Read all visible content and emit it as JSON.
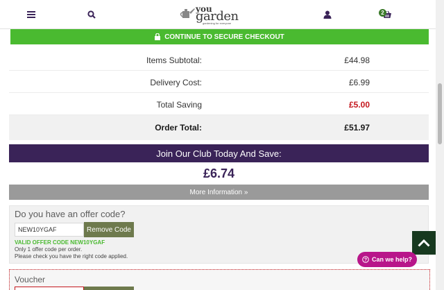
{
  "header": {
    "icons": [
      "hamburger-menu-icon",
      "search-icon",
      "account-icon",
      "basket-icon"
    ],
    "basket_count": "2",
    "logo_you": "you",
    "logo_garden": "garden",
    "logo_tagline": "gardening for everyone"
  },
  "checkout": {
    "label": "CONTINUE TO SECURE CHECKOUT",
    "icon": "padlock-icon"
  },
  "totals": {
    "subtotal_label": "Items Subtotal:",
    "subtotal_value": "£44.98",
    "delivery_label": "Delivery Cost:",
    "delivery_value": "£6.99",
    "saving_label": "Total Saving",
    "saving_value": "£5.00",
    "order_label": "Order Total:",
    "order_value": "£51.97"
  },
  "club": {
    "heading": "Join Our Club Today And Save:",
    "price": "£6.74",
    "more_info": "More Information »"
  },
  "offer": {
    "title": "Do you have an offer code?",
    "code_value": "NEW10YGAF",
    "remove_label": "Remove Code",
    "valid_text": "VALID OFFER CODE NEW10YGAF",
    "note1": "Only 1 offer code per order.",
    "note2": "Please check you have the right code applied."
  },
  "voucher": {
    "title": "Voucher"
  },
  "help": {
    "label": "Can we help?"
  },
  "colors": {
    "brand_green": "#4aba30",
    "club_purple": "#3a2358",
    "saving_red": "#c4161c",
    "help_magenta": "#b8168a",
    "button_olive": "#6e7a4d"
  }
}
